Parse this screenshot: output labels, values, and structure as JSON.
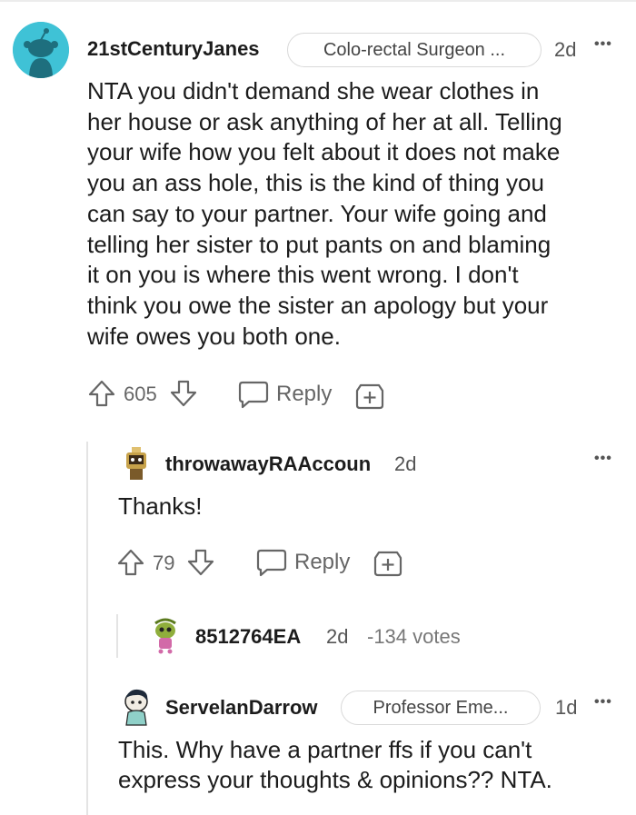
{
  "comments": [
    {
      "username": "21stCenturyJanes",
      "flair": "Colo-rectal Surgeon ...",
      "age": "2d",
      "more": "•••",
      "body_lines": [
        "NTA you didn't demand she wear clothes in",
        "her house or ask anything of her at all. Telling",
        "your wife how you felt about it does not make",
        "you an ass hole, this is the kind of thing you",
        "can say to your partner. Your wife going and",
        "telling her sister to put pants on and blaming",
        "it on you is where this went wrong. I don't",
        "think you owe the sister an apology but your",
        "wife owes you both one."
      ],
      "votes": "605",
      "reply_label": "Reply"
    },
    {
      "username": "throwawayRAAccoun",
      "age": "2d",
      "more": "•••",
      "body": "Thanks!",
      "votes": "79",
      "reply_label": "Reply"
    },
    {
      "username": "8512764EA",
      "age": "2d",
      "votes_text": "-134 votes"
    },
    {
      "username": "ServelanDarrow",
      "flair": "Professor Eme...",
      "age": "1d",
      "more": "•••",
      "body_lines": [
        "This. Why have a partner ffs if you can't",
        "express your thoughts & opinions?? NTA."
      ]
    }
  ],
  "colors": {
    "accent_avatar": "#3fc2d6",
    "text": "#1c1c1c",
    "muted": "#666666"
  },
  "icons": [
    "snoo-avatar",
    "upvote-icon",
    "downvote-icon",
    "reply-bubble-icon",
    "award-plus-icon"
  ]
}
